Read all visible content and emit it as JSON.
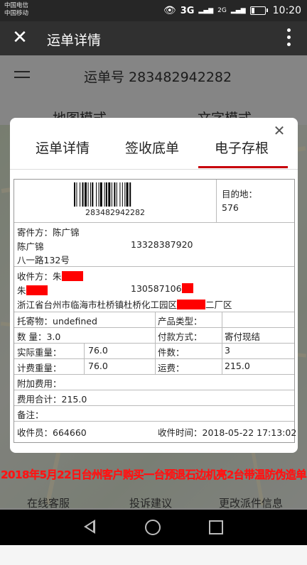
{
  "status_bar": {
    "carrier1": "中国电信",
    "carrier2": "中国移动",
    "net1": "3G",
    "net2": "2G",
    "time": "10:20"
  },
  "app_bar": {
    "title": "运单详情"
  },
  "background": {
    "waybill": "运单号 283482942282",
    "tab_map": "地图模式",
    "tab_text": "文字模式",
    "bottom_items": [
      "在线客服",
      "投诉建议",
      "更改派件信息"
    ]
  },
  "annotation": "2018年5月22日台州客户购买一台预退石边机亮2台带温防伪造单",
  "modal": {
    "tabs": [
      "运单详情",
      "签收底单",
      "电子存根"
    ],
    "active_tab": "电子存根",
    "barcode_number": "283482942282",
    "destination_label": "目的地：",
    "destination_value": "576",
    "sender_label": "寄件方：",
    "sender_name_header": "陈广锦",
    "sender_name": "陈广锦",
    "sender_phone": "13328387920",
    "sender_address": "八一路132号",
    "receiver_label": "收件方：",
    "receiver_name_header": "朱",
    "receiver_name": "朱",
    "receiver_phone": "130587106",
    "receiver_address": "浙江省台州市临海市杜桥镇杜桥化工园区",
    "receiver_address_suffix": "二厂区",
    "item_label": "托寄物：",
    "item_value": "undefined",
    "product_label": "产品类型：",
    "quantity_label": "数  量：",
    "quantity_value": "3.0",
    "payment_label": "付款方式：",
    "payment_value": "寄付现结",
    "actual_weight_label": "实际重量：",
    "actual_weight_value": "76.0",
    "pieces_label": "件数：",
    "pieces_value": "3",
    "charge_weight_label": "计费重量：",
    "charge_weight_value": "76.0",
    "freight_label": "运费：",
    "freight_value": "215.0",
    "extra_fee_label": "附加费用：",
    "total_label": "费用合计：",
    "total_value": "215.0",
    "remark_label": "备注：",
    "collector_label": "收件员：",
    "collector_value": "664660",
    "collect_time_label": "收件时间：",
    "collect_time_value": "2018-05-22 17:13:02"
  },
  "colors": {
    "accent": "#c7000b",
    "redaction": "#ff0000",
    "annotation": "#ff1414"
  }
}
